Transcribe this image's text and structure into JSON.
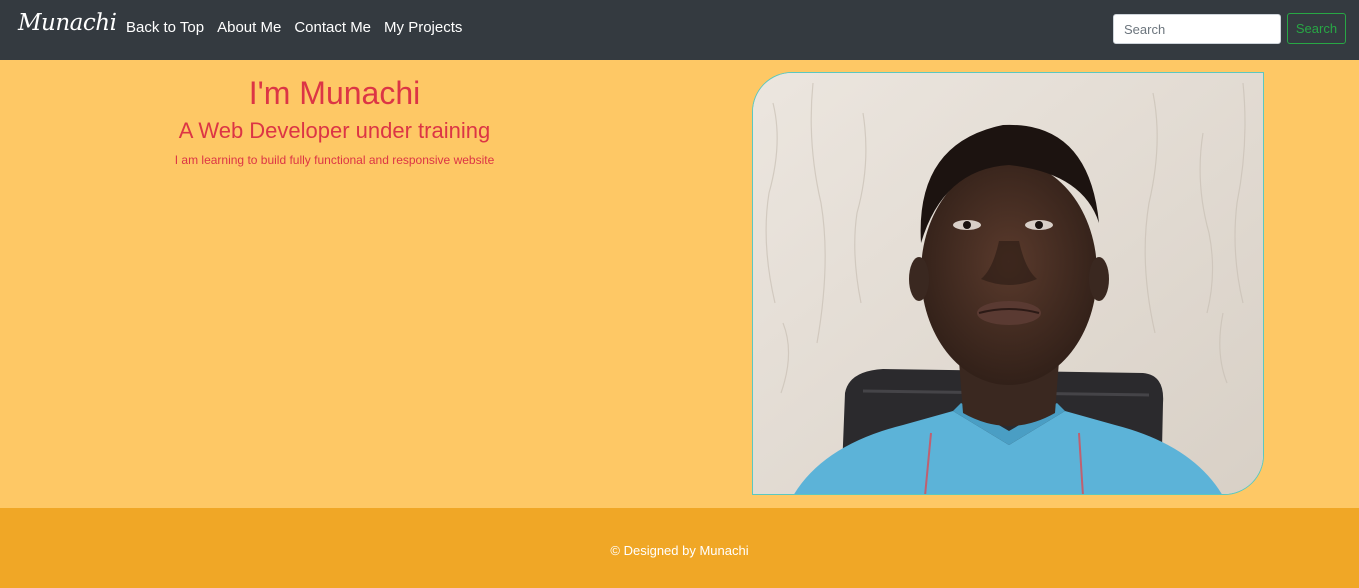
{
  "navbar": {
    "brand": "Munachi",
    "links": [
      {
        "label": "Back to Top"
      },
      {
        "label": "About Me"
      },
      {
        "label": "Contact Me"
      },
      {
        "label": "My Projects"
      }
    ],
    "search": {
      "placeholder": "Search",
      "value": "",
      "button_label": "Search"
    }
  },
  "hero": {
    "title": "I'm Munachi",
    "subtitle": "A Web Developer under training",
    "description": "I am learning to build fully functional and responsive website",
    "photo_icon": "profile-photo"
  },
  "footer": {
    "text": "© Designed by Munachi"
  },
  "colors": {
    "navbar_bg": "#343a40",
    "hero_bg": "#fec865",
    "accent_text": "#dc3545",
    "footer_bg": "#f0a726",
    "search_button": "#28a745",
    "photo_border": "#5bc8c0"
  }
}
